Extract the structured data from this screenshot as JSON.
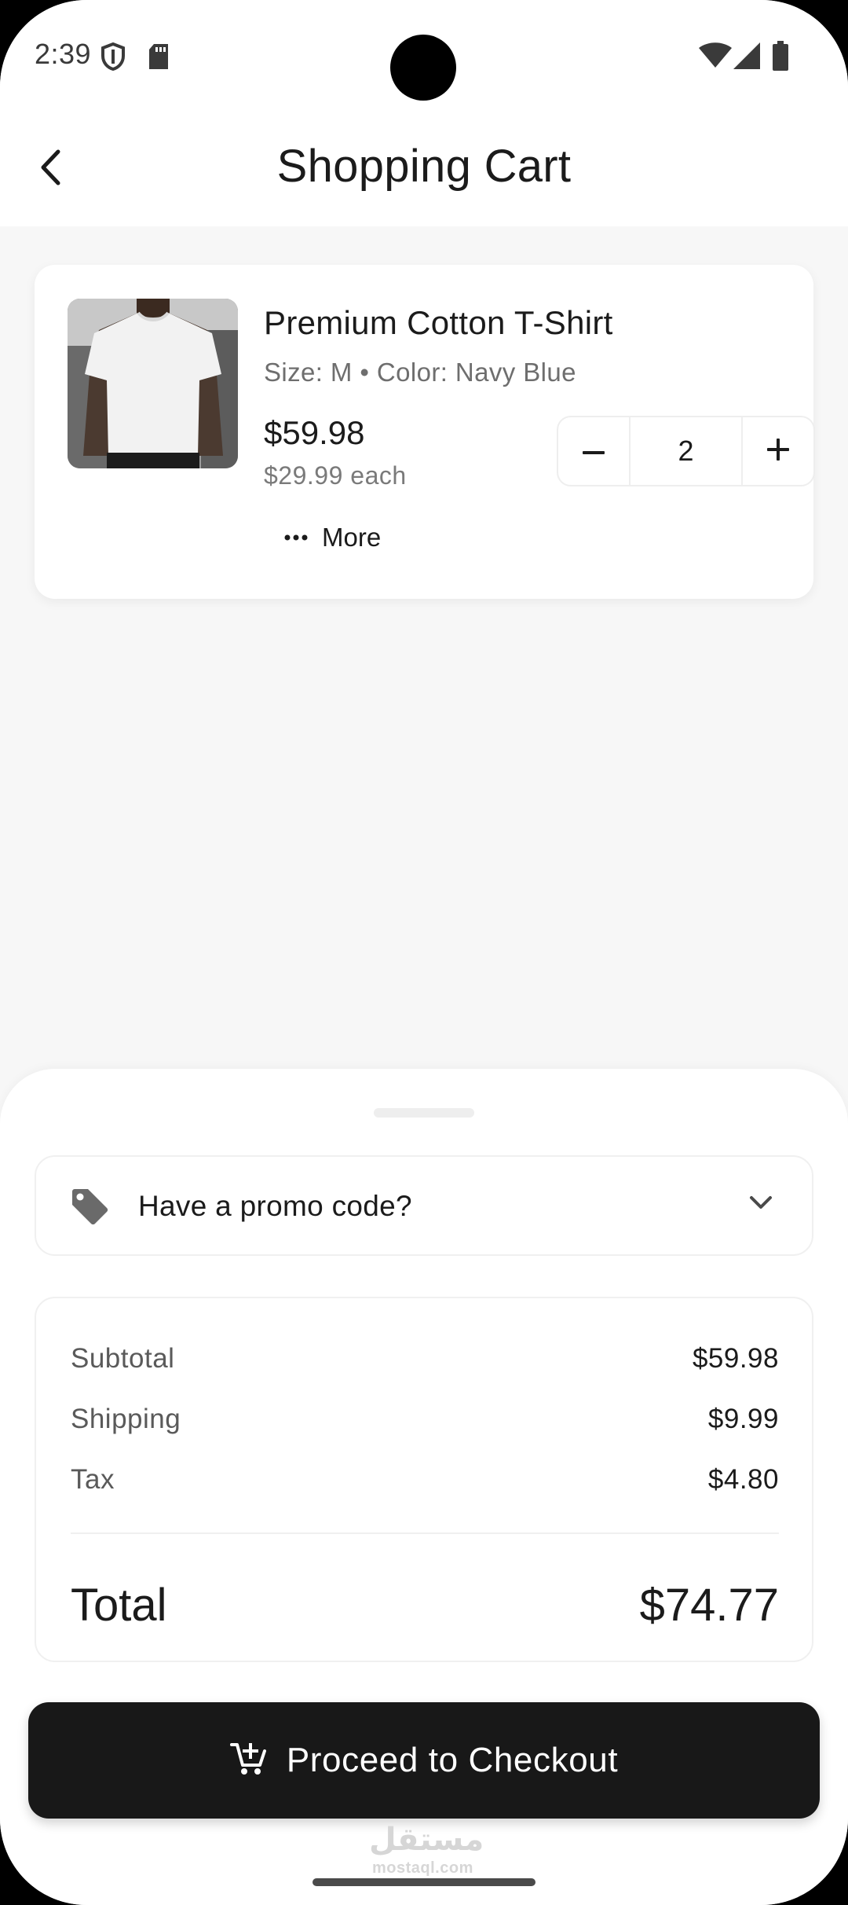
{
  "status_bar": {
    "time": "2:39",
    "left_icons": [
      "shield-icon",
      "sd-card-icon"
    ],
    "right_icons": [
      "wifi-icon",
      "cellular-signal-icon",
      "battery-icon"
    ]
  },
  "header": {
    "title": "Shopping Cart",
    "back_icon": "chevron-left-icon"
  },
  "cart_items": [
    {
      "name": "Premium Cotton T-Shirt",
      "variant": "Size: M • Color: Navy Blue",
      "line_price": "$59.98",
      "unit_price": "$29.99 each",
      "quantity": "2",
      "more_label": "More"
    }
  ],
  "promo": {
    "label": "Have a promo code?",
    "icon": "tag-icon"
  },
  "summary": {
    "subtotal_label": "Subtotal",
    "subtotal_value": "$59.98",
    "shipping_label": "Shipping",
    "shipping_value": "$9.99",
    "tax_label": "Tax",
    "tax_value": "$4.80",
    "total_label": "Total",
    "total_value": "$74.77"
  },
  "checkout": {
    "label": "Proceed to Checkout",
    "icon": "cart-add-icon"
  },
  "watermark": {
    "arabic": "مستقل",
    "url": "mostaql.com"
  },
  "colors": {
    "background": "#f7f7f7",
    "surface": "#ffffff",
    "primary_button": "#181818",
    "text_primary": "#1b1b1b",
    "text_secondary": "#6e6e6e"
  }
}
